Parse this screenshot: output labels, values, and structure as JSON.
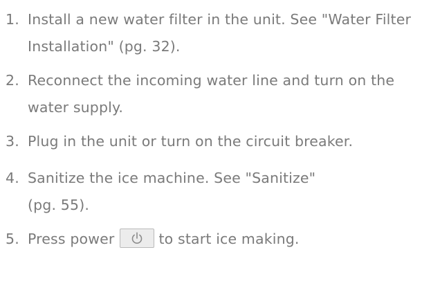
{
  "steps": [
    {
      "number": "1.",
      "text": "Install a new water filter in the unit. See \"Water Filter Installation\" (pg. 32)."
    },
    {
      "number": "2.",
      "text": "Reconnect the incoming water line and turn on the water supply."
    },
    {
      "number": "3.",
      "text": "Plug in the unit or turn on the circuit breaker."
    },
    {
      "number": "4.",
      "text_line1": "Sanitize the ice machine. See \"Sanitize\"",
      "text_line2": "(pg. 55)."
    },
    {
      "number": "5.",
      "text_before": "Press power",
      "text_after": "to start ice making.",
      "icon": "power-icon"
    }
  ],
  "colors": {
    "text": "#7a7a7a",
    "button_bg": "#ececec",
    "button_border": "#b9b9b9"
  }
}
